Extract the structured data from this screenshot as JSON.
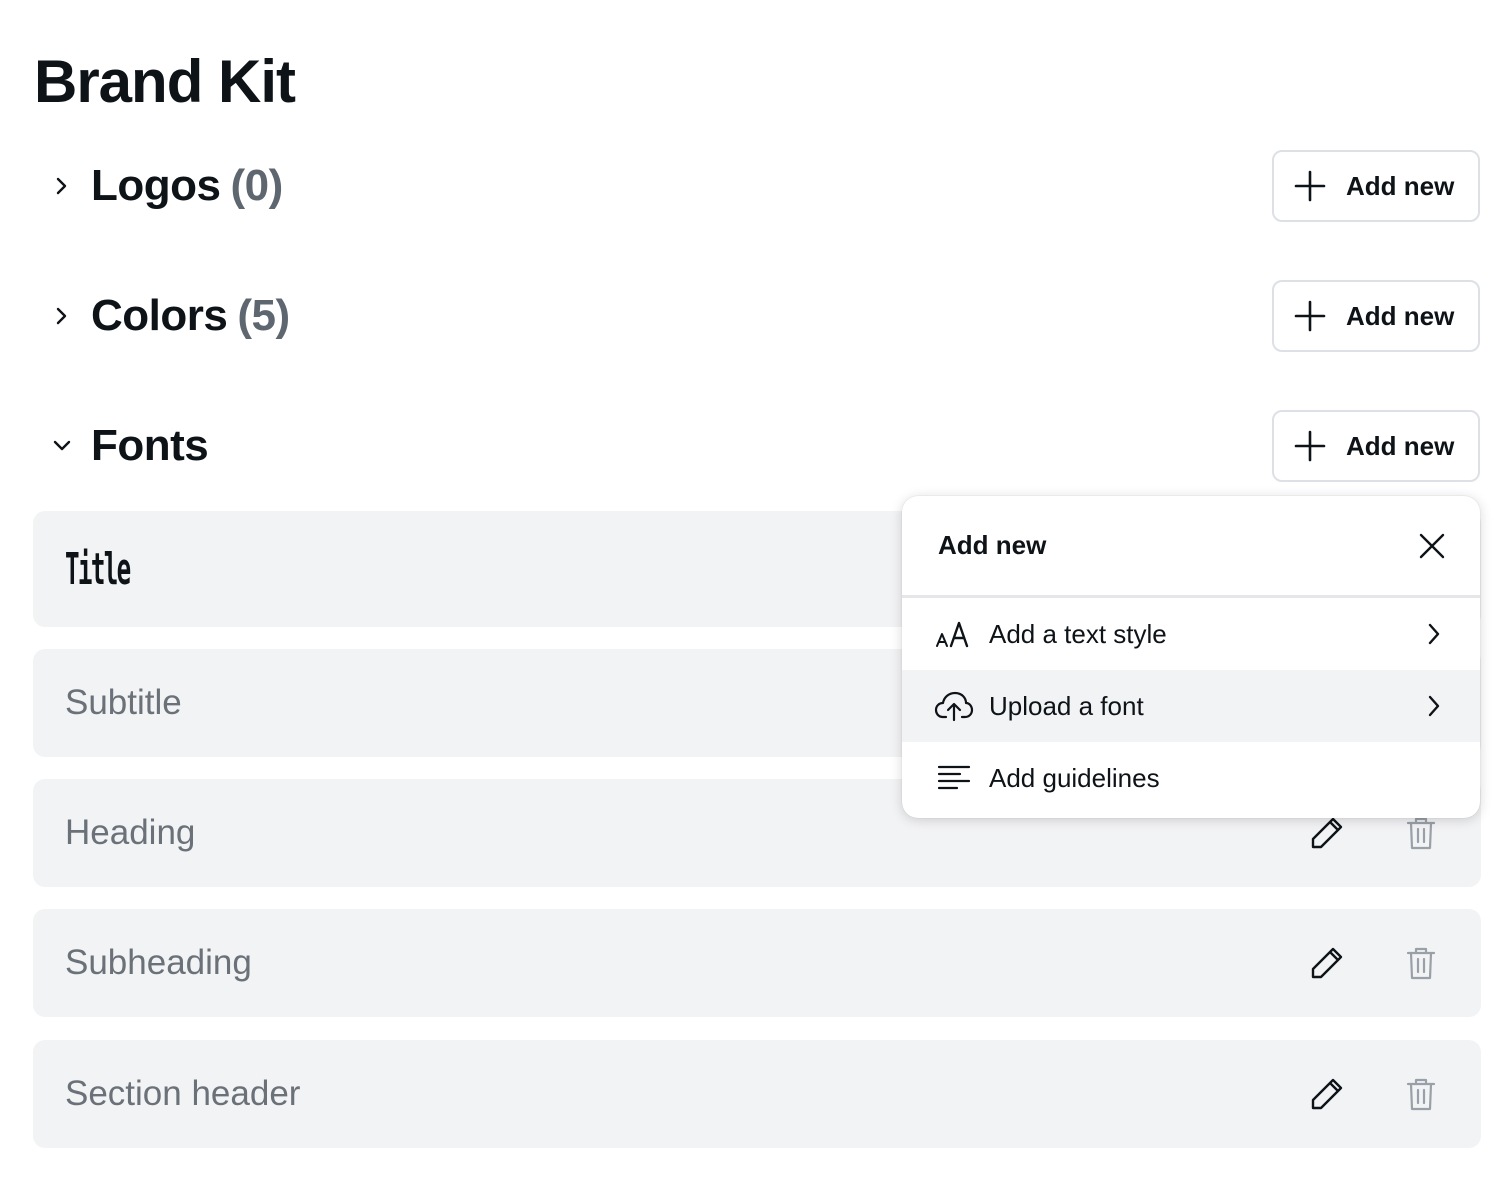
{
  "page": {
    "title": "Brand Kit"
  },
  "sections": [
    {
      "title": "Logos",
      "count": "(0)",
      "expanded": false,
      "add_label": "Add new"
    },
    {
      "title": "Colors",
      "count": "(5)",
      "expanded": false,
      "add_label": "Add new"
    },
    {
      "title": "Fonts",
      "count": "",
      "expanded": true,
      "add_label": "Add new"
    }
  ],
  "fonts": [
    {
      "name": "Title"
    },
    {
      "name": "Subtitle"
    },
    {
      "name": "Heading"
    },
    {
      "name": "Subheading"
    },
    {
      "name": "Section header"
    }
  ],
  "popover": {
    "title": "Add new",
    "items": [
      {
        "label": "Add a text style",
        "icon": "text-size-icon",
        "has_submenu": true
      },
      {
        "label": "Upload a font",
        "icon": "cloud-upload-icon",
        "has_submenu": true,
        "highlighted": true
      },
      {
        "label": "Add guidelines",
        "icon": "guidelines-icon",
        "has_submenu": false
      }
    ]
  },
  "colors": {
    "text": "#0e1318",
    "muted": "#6b7178",
    "card_bg": "#f2f3f5",
    "border": "#dde1e5"
  }
}
